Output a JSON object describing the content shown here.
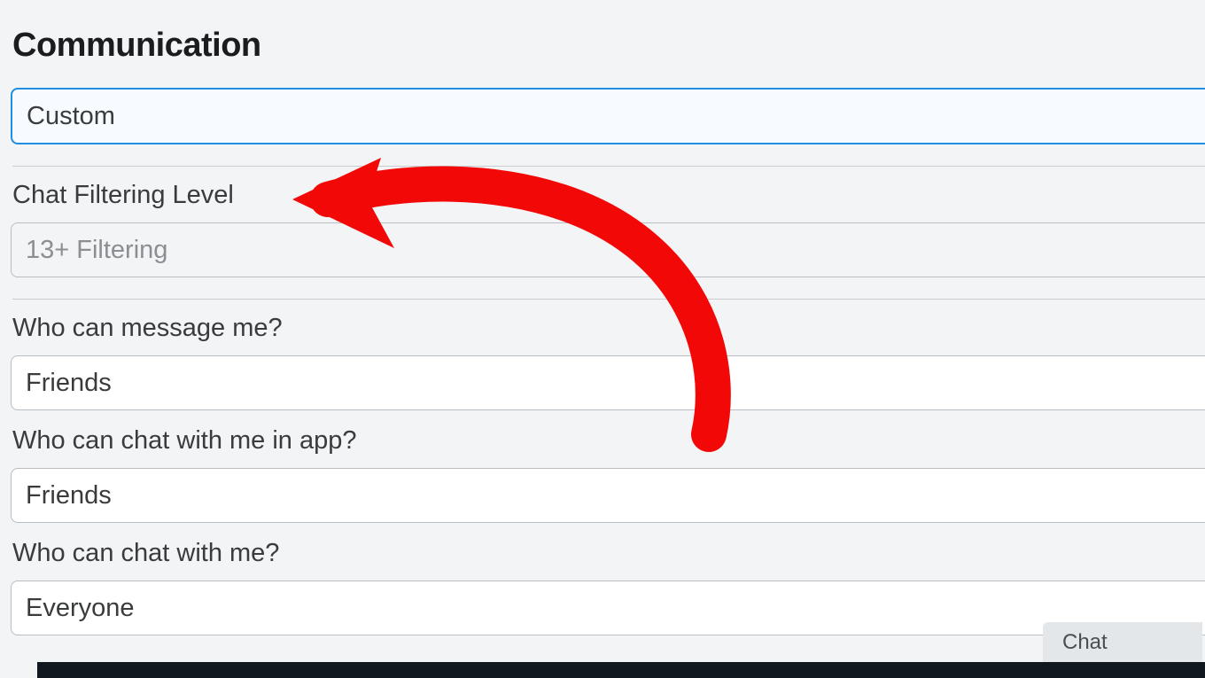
{
  "section": {
    "title": "Communication"
  },
  "fields": {
    "mode": {
      "value": "Custom"
    },
    "chatFilter": {
      "label": "Chat Filtering Level",
      "value": "13+ Filtering"
    },
    "whoMessage": {
      "label": "Who can message me?",
      "value": "Friends"
    },
    "whoChatInApp": {
      "label": "Who can chat with me in app?",
      "value": "Friends"
    },
    "whoChat": {
      "label": "Who can chat with me?",
      "value": "Everyone"
    }
  },
  "chatTab": {
    "label": "Chat"
  },
  "annotation": {
    "color": "#f30808"
  }
}
